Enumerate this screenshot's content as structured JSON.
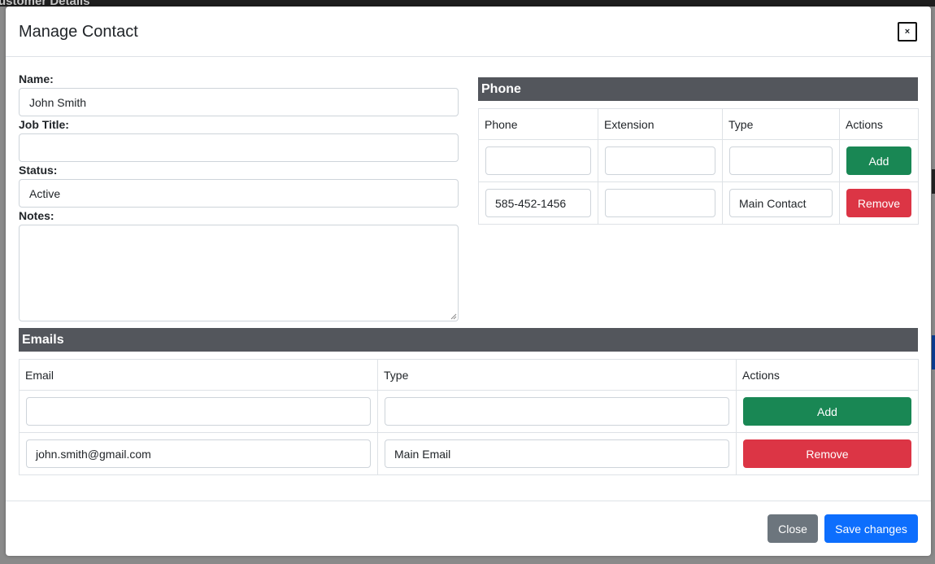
{
  "background": {
    "title_fragment": "ustomer Details"
  },
  "modal": {
    "title": "Manage Contact",
    "close_icon": "×"
  },
  "form": {
    "name_label": "Name:",
    "name_value": "John Smith",
    "job_title_label": "Job Title:",
    "job_title_value": "",
    "status_label": "Status:",
    "status_value": "Active",
    "notes_label": "Notes:",
    "notes_value": ""
  },
  "phone": {
    "section_title": "Phone",
    "headers": [
      "Phone",
      "Extension",
      "Type",
      "Actions"
    ],
    "new_row": {
      "phone": "",
      "extension": "",
      "type": "",
      "action": "Add"
    },
    "rows": [
      {
        "phone": "585-452-1456",
        "extension": "",
        "type": "Main Contact",
        "action": "Remove"
      }
    ]
  },
  "emails": {
    "section_title": "Emails",
    "headers": [
      "Email",
      "Type",
      "Actions"
    ],
    "new_row": {
      "email": "",
      "type": "",
      "action": "Add"
    },
    "rows": [
      {
        "email": "john.smith@gmail.com",
        "type": "Main Email",
        "action": "Remove"
      }
    ]
  },
  "footer": {
    "close_label": "Close",
    "save_label": "Save changes"
  },
  "colors": {
    "section_bar": "#53565c",
    "add_button": "#198754",
    "remove_button": "#dc3545",
    "close_button": "#6c757d",
    "save_button": "#0d6efd"
  }
}
